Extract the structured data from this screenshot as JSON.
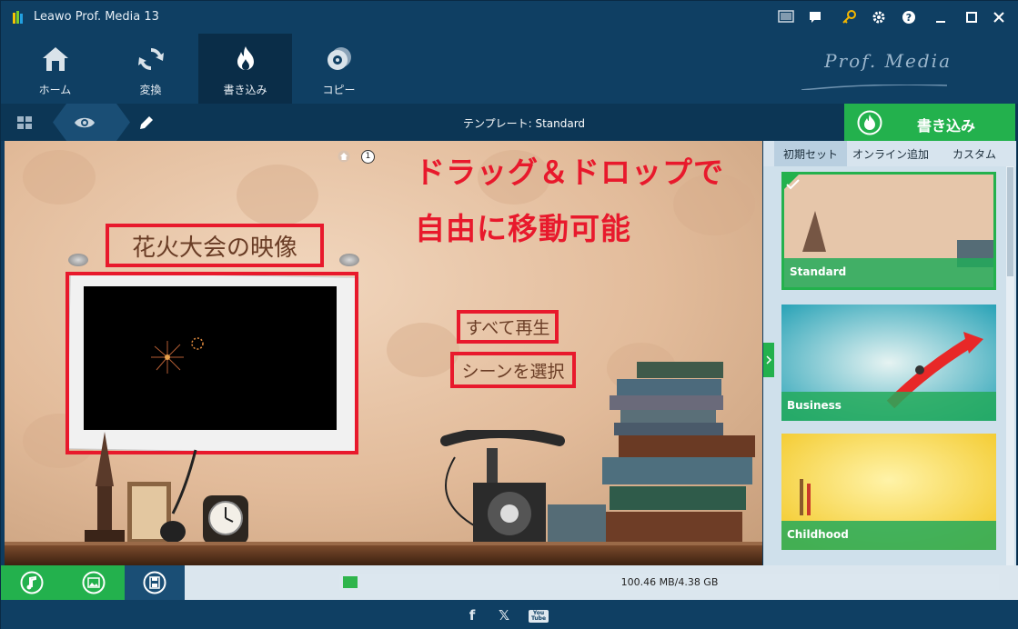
{
  "window": {
    "title": "Leawo Prof. Media 13"
  },
  "nav": [
    {
      "label": "ホーム",
      "icon": "home-icon"
    },
    {
      "label": "変換",
      "icon": "convert-icon"
    },
    {
      "label": "書き込み",
      "icon": "burn-flame-icon"
    },
    {
      "label": "コピー",
      "icon": "copy-disc-icon"
    }
  ],
  "brand": "Prof. Media",
  "subbar": {
    "template_label": "テンプレート: Standard"
  },
  "burn_button": {
    "label": "書き込み"
  },
  "preview": {
    "page_number": "1",
    "annotation": {
      "line1": "ドラッグ＆ドロップで",
      "line2": "自由に移動可能"
    },
    "video_title": "花火大会の映像",
    "play_all": "すべて再生",
    "select_scene": "シーンを選択"
  },
  "sidebar": {
    "tabs": [
      "初期セット",
      "オンライン追加",
      "カスタム"
    ],
    "templates": [
      {
        "name": "Standard",
        "selected": true
      },
      {
        "name": "Business",
        "selected": false
      },
      {
        "name": "Childhood",
        "selected": false
      }
    ]
  },
  "status": {
    "size_text": "100.46 MB/4.38 GB",
    "used_fraction": 0.022
  },
  "colors": {
    "accent_green": "#23b14d",
    "annotation_red": "#e8192c",
    "chrome_blue": "#0f3f63"
  },
  "footer": {
    "social": [
      "f",
      "𝕏",
      "You Tube"
    ]
  }
}
